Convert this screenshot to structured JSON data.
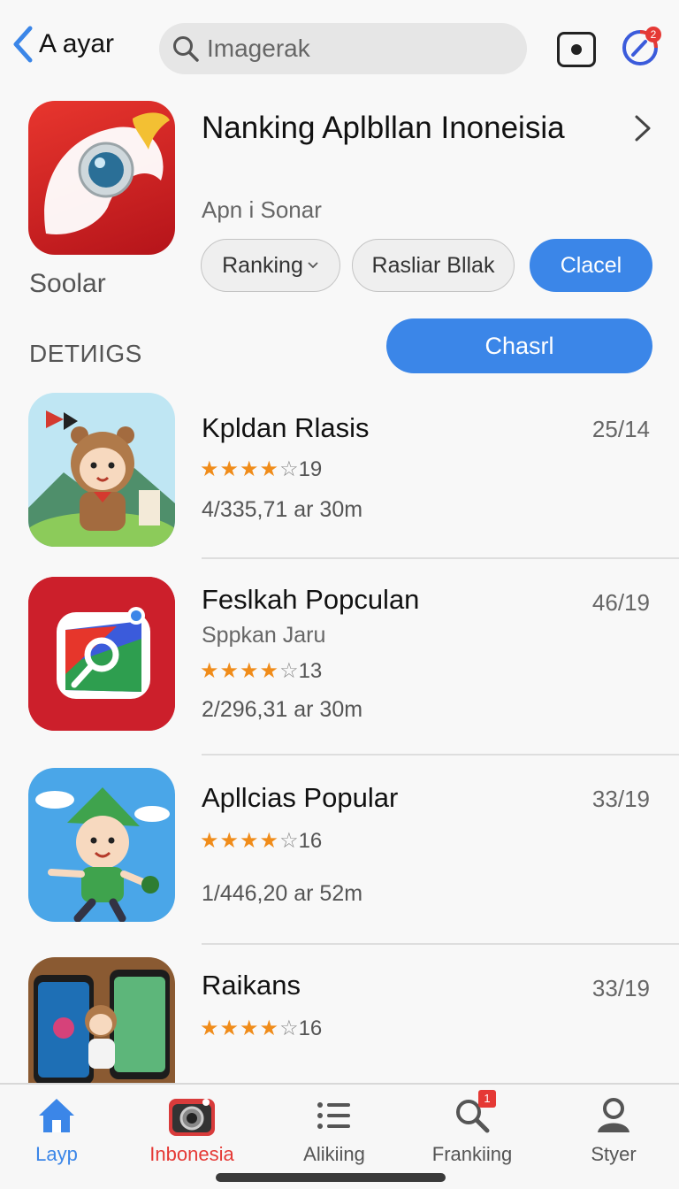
{
  "header": {
    "back_label": "A ayar",
    "search_placeholder": "Imagerak",
    "profile_badge": "2"
  },
  "hero": {
    "title": "Nanking Aplbllan Inoneisia",
    "subtitle": "Apn i Sonar",
    "icon_label": "Soolar",
    "pill_ranking": "Ranking",
    "pill_rasliar": "Rasliar Bllak",
    "pill_clacel": "Clacel",
    "section_label": "DETИIGS",
    "primary_button": "Chasrl"
  },
  "apps": [
    {
      "title": "Kpldan Rlasis",
      "subtitle": "",
      "stars": "★★★★",
      "rating_count": "19",
      "meta": "4/335,71 ar  30m",
      "date": "25/14"
    },
    {
      "title": "Feslkah Popculan",
      "subtitle": "Sppkan Jaru",
      "stars": "★★★★",
      "rating_count": "13",
      "meta": "2/296,31 ar  30m",
      "date": "46/19"
    },
    {
      "title": "Apllcias Popular",
      "subtitle": "",
      "stars": "★★★★",
      "rating_count": "16",
      "meta": "1/446,20 ar  52m",
      "date": "33/19"
    },
    {
      "title": "Raikans",
      "subtitle": "",
      "stars": "★★★★",
      "rating_count": "16",
      "meta": "",
      "date": "33/19"
    }
  ],
  "bottom_nav": {
    "items": [
      {
        "label": "Layp",
        "icon": "home-icon",
        "color": "#3b86e8"
      },
      {
        "label": "Inbonesia",
        "icon": "camera-icon",
        "color": "#e53935"
      },
      {
        "label": "Alikiing",
        "icon": "list-icon",
        "color": "#555555"
      },
      {
        "label": "Frankiing",
        "icon": "search-icon",
        "color": "#555555",
        "badge": "1"
      },
      {
        "label": "Styer",
        "icon": "person-icon",
        "color": "#555555"
      }
    ]
  },
  "colors": {
    "accent": "#3b86e8",
    "star": "#f08c1a",
    "badge": "#e53935"
  }
}
